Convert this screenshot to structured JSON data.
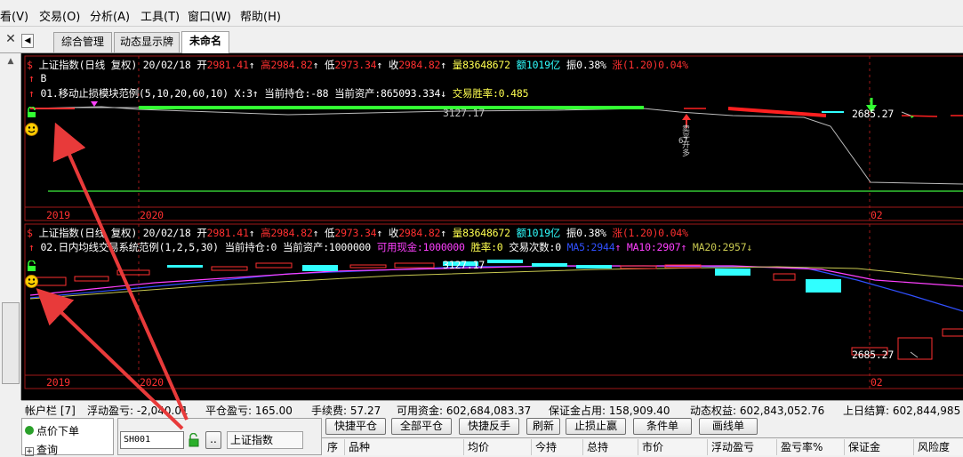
{
  "menu": [
    {
      "label": "看(V)"
    },
    {
      "label": "交易(O)"
    },
    {
      "label": "分析(A)"
    },
    {
      "label": "工具(T)"
    },
    {
      "label": "窗口(W)"
    },
    {
      "label": "帮助(H)"
    }
  ],
  "tabs": [
    {
      "label": "综合管理"
    },
    {
      "label": "动态显示牌"
    },
    {
      "label": "未命名"
    }
  ],
  "panel1": {
    "header_symbol": "$",
    "title": "上证指数(日线 复权)",
    "date": "20/02/18",
    "open_label": "开",
    "open": "2981.41",
    "high_label": "高",
    "high": "2984.82",
    "low_label": "低",
    "low": "2973.34",
    "close_label": "收",
    "close": "2984.82",
    "vol_label": "量",
    "vol": "83648672",
    "amt_label": "额",
    "amt": "1019亿",
    "amp_label": "振",
    "amp": "0.38%",
    "chg_label": "涨",
    "chg": "(1.20)0.04%",
    "line2": "B",
    "strategy": "01.移动止损模块范例(5,10,20,60,10) X:3",
    "pos": "当前持仓:-88",
    "assets": "当前资产:865093.334",
    "win": "交易胜率:0.485",
    "mark_high": "3127.17",
    "mark_low": "2685.27",
    "signal_text": "卖平开多",
    "signal_num": "67",
    "year_2019": "2019",
    "year_2020": "2020",
    "month_02": "02"
  },
  "panel2": {
    "header_symbol": "$",
    "title": "上证指数(日线 复权)",
    "date": "20/02/18",
    "open_label": "开",
    "open": "2981.41",
    "high_label": "高",
    "high": "2984.82",
    "low_label": "低",
    "low": "2973.34",
    "close_label": "收",
    "close": "2984.82",
    "vol_label": "量",
    "vol": "83648672",
    "amt_label": "额",
    "amt": "1019亿",
    "amp_label": "振",
    "amp": "0.38%",
    "chg_label": "涨",
    "chg": "(1.20)0.04%",
    "strategy": "02.日内均线交易系统范例(1,2,5,30)",
    "pos": "当前持仓:0",
    "assets": "当前资产:1000000",
    "cash": "可用现金:1000000",
    "win": "胜率:0",
    "trades": "交易次数:0",
    "ma5": "MA5:2944",
    "ma10": "MA10:2907",
    "ma20": "MA20:2957",
    "mark_high": "3127.17",
    "mark_low": "2685.27",
    "year_2019": "2019",
    "year_2020": "2020",
    "month_02": "02"
  },
  "status": {
    "account": "帐户栏 [7]",
    "float_pnl": "浮动盈亏: -2,040.01",
    "close_pnl": "平仓盈亏: 165.00",
    "fee": "手续费: 57.27",
    "avail": "可用资金: 602,684,083.37",
    "margin": "保证金占用: 158,909.40",
    "equity": "动态权益: 602,843,052.76",
    "last": "上日结算: 602,844,985"
  },
  "bottom": {
    "tree_item1": "点价下单",
    "tree_item2": "查询",
    "code_value": "SH001",
    "dots": "..",
    "name_value": "上证指数",
    "buttons": [
      "快捷平仓",
      "全部平仓",
      "快捷反手",
      "刷新",
      "止损止赢",
      "条件单",
      "画线单"
    ],
    "columns": [
      "序",
      "品种",
      "均价",
      "今持",
      "总持",
      "市价",
      "浮动盈亏",
      "盈亏率%",
      "保证金",
      "风险度"
    ]
  },
  "colors": {
    "up": "#ff3030",
    "down": "#30ffff",
    "green": "#32ff32",
    "ma5": "#3050ff",
    "ma10": "#ff40ff",
    "ma20": "#c8c850",
    "annotation_arrow": "#e83a3a"
  }
}
